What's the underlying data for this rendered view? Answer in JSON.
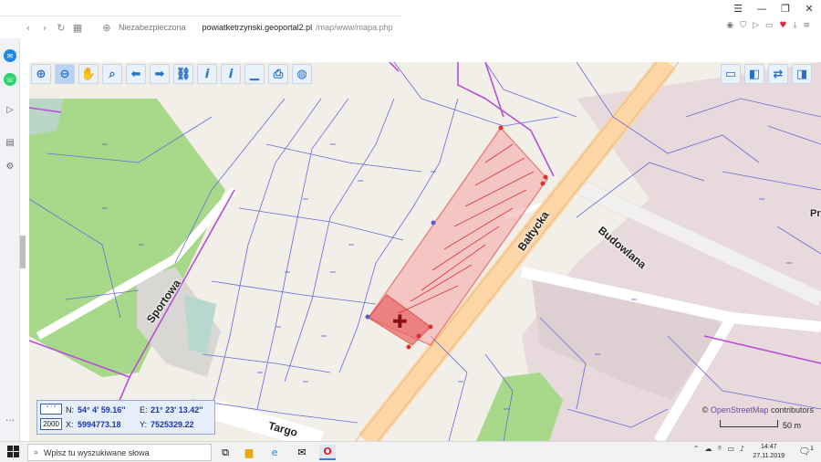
{
  "browser": {
    "security_label": "Niezabezpieczona",
    "url_host": "powiatketrzynski.geoportal2.pl",
    "url_path": "/map/www/mapa.php",
    "icons": [
      "back-icon",
      "forward-icon",
      "reload-icon",
      "tabs-icon",
      "globe-icon"
    ],
    "window_controls": [
      "minimize",
      "maximize",
      "close"
    ]
  },
  "map": {
    "roads": [
      "Sportowa",
      "Bałtycka",
      "Budowlana",
      "Targo"
    ],
    "truncated_label": "Pr",
    "attribution_link": "OpenStreetMap",
    "attribution_suffix": "contributors",
    "scale_label": "50 m",
    "parcel_colors": {
      "selection_fill": "#f4a6a6",
      "selection_stroke": "#e03030",
      "boundary": "#b84fd6",
      "parcels": "#6a6ad8"
    }
  },
  "toolbar": {
    "tools": [
      "zoom-in",
      "zoom-out",
      "pan",
      "zoom-box",
      "back",
      "forward",
      "link",
      "info",
      "info-doc",
      "measure",
      "print",
      "globe"
    ],
    "right_tools": [
      "layout-top",
      "layout-left",
      "export",
      "layout-right"
    ]
  },
  "coords": {
    "unit_button": "° ' \"",
    "system_button": "2000",
    "n_label": "N:",
    "n_value": "54° 4' 59.16''",
    "e_label": "E:",
    "e_value": "21° 23' 13.42''",
    "x_label": "X:",
    "x_value": "5994773.18",
    "y_label": "Y:",
    "y_value": "7525329.22"
  },
  "taskbar": {
    "search_placeholder": "Wpisz tu wyszukiwane słowa",
    "time": "14:47",
    "date": "27.11.2019",
    "notification_count": "1"
  }
}
